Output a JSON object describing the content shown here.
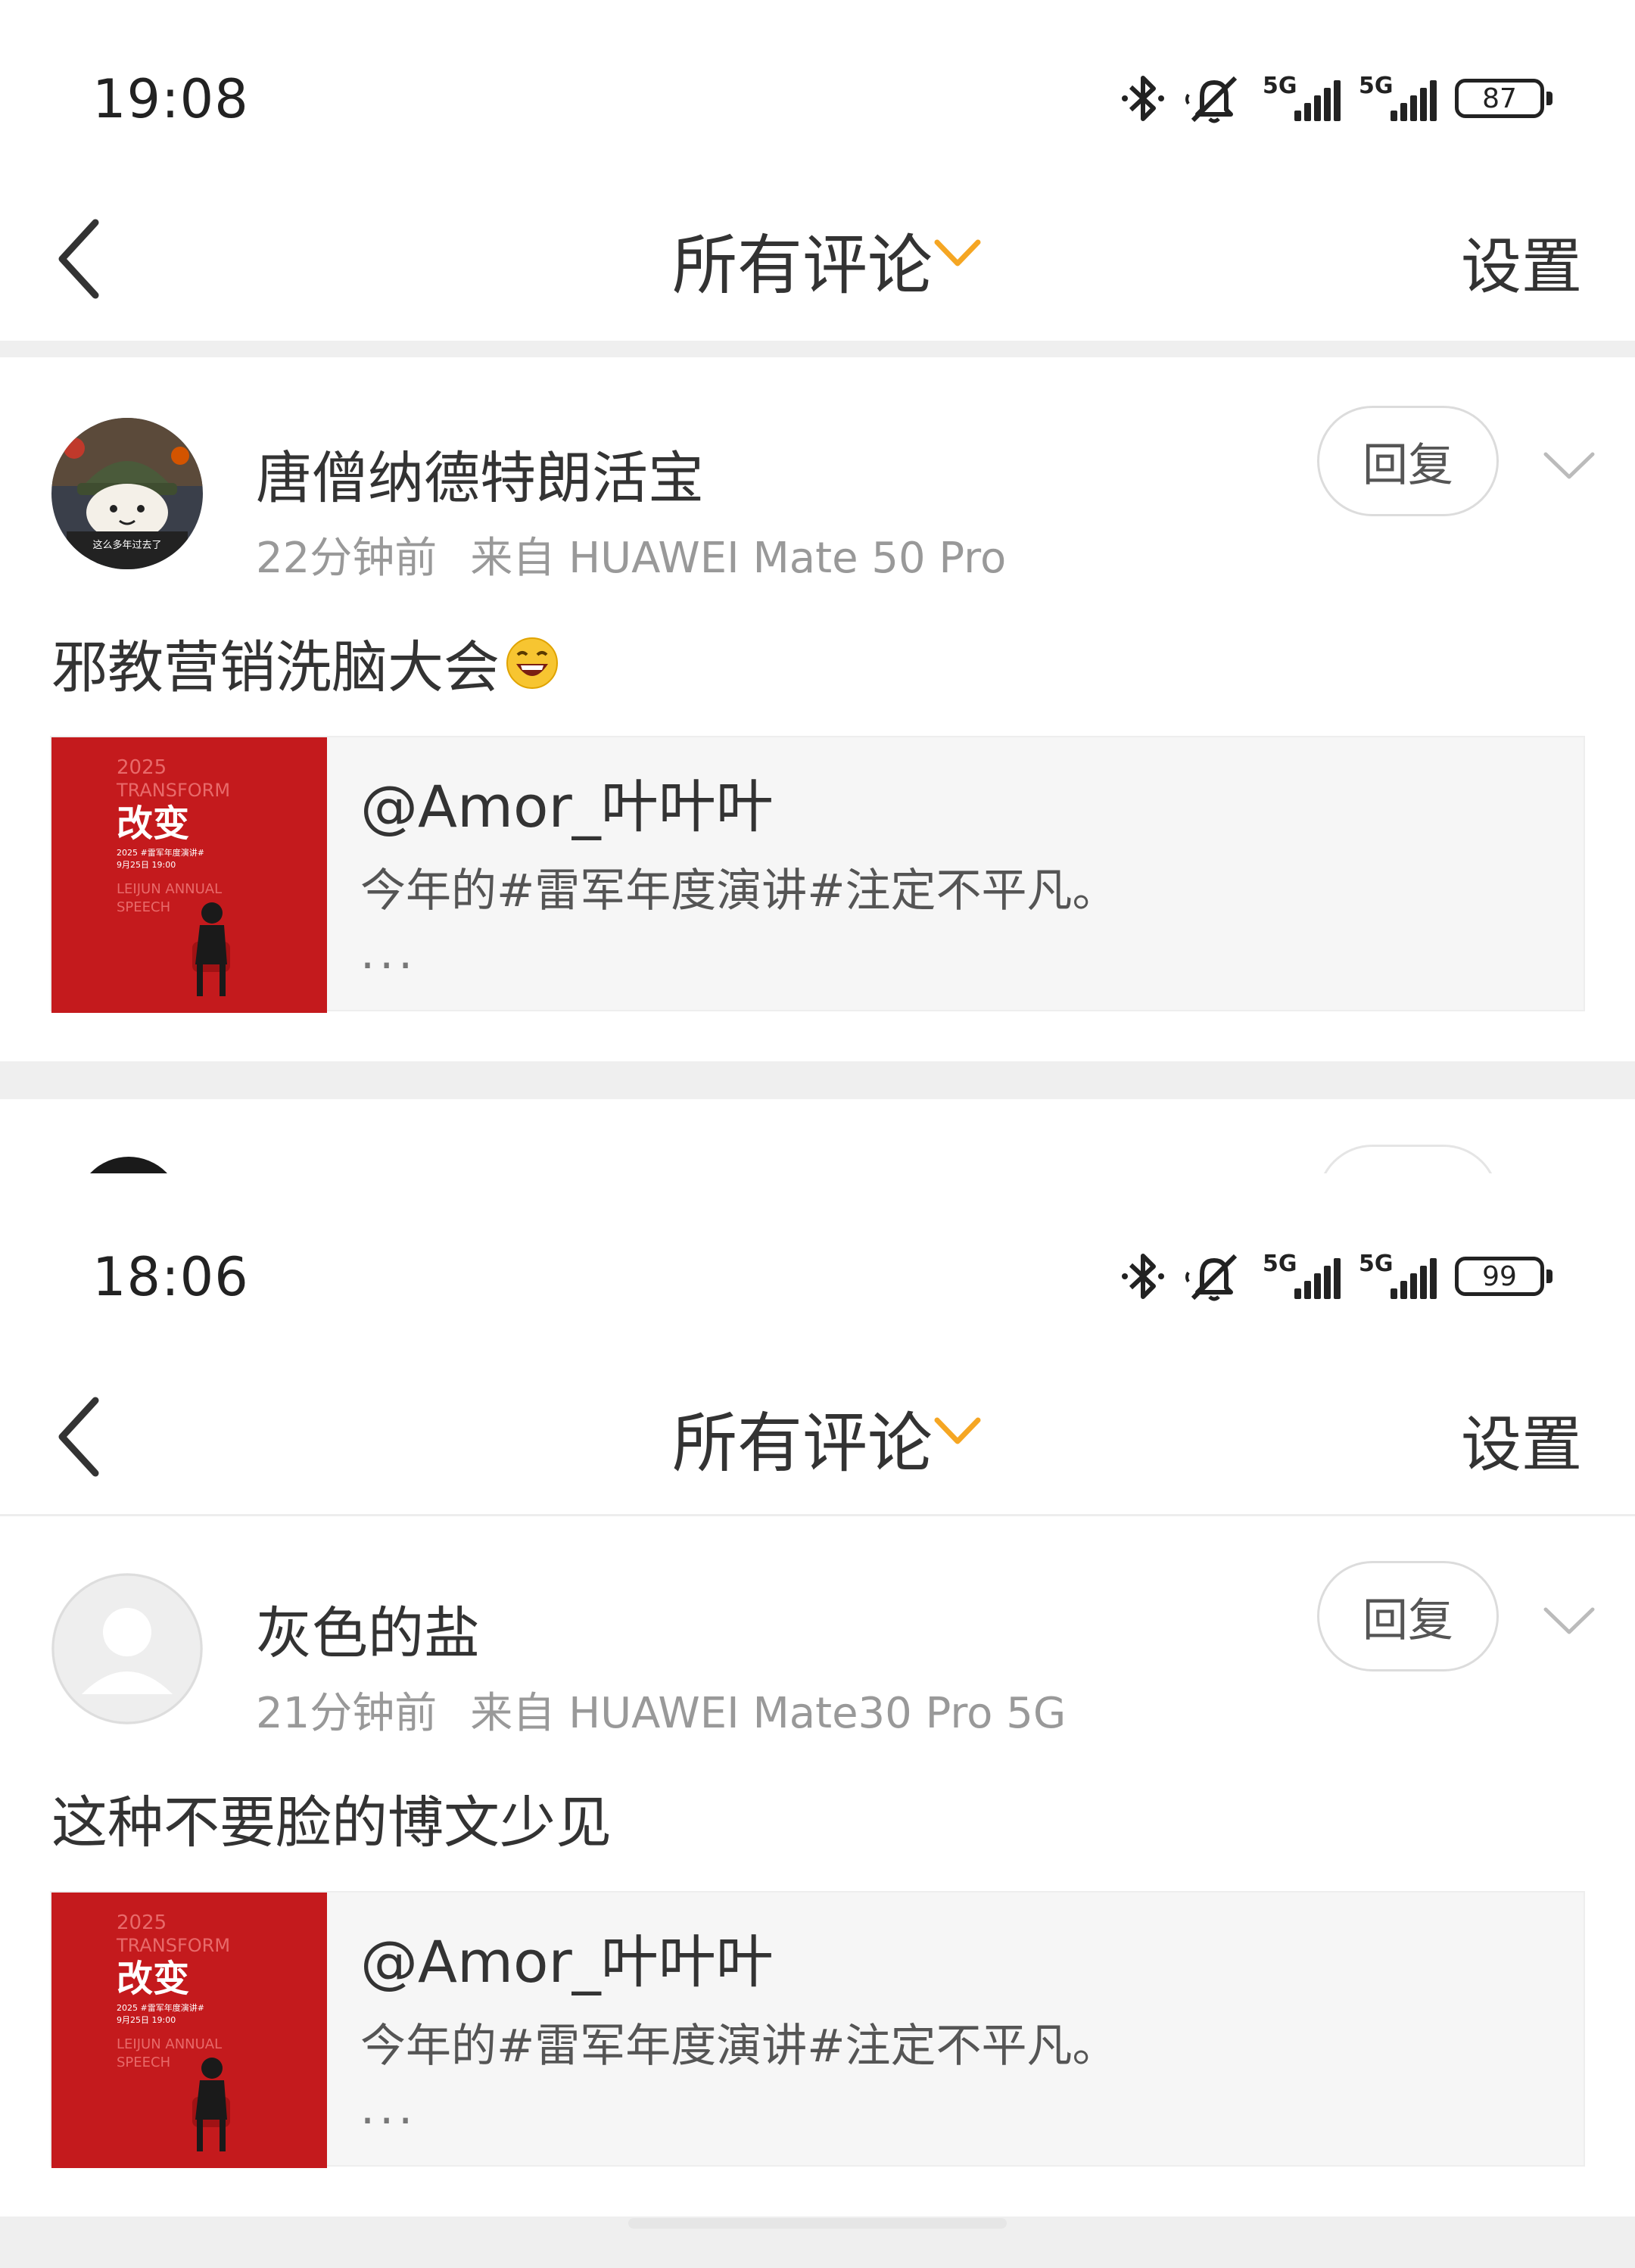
{
  "colors": {
    "accent": "#f5a623",
    "text": "#333333",
    "meta": "#999999",
    "thumb_red": "#c41a1d"
  },
  "screens": [
    {
      "status": {
        "time": "19:08",
        "battery": "87",
        "net1": "5G",
        "net2": "5G"
      },
      "nav": {
        "title": "所有评论",
        "settings": "设置"
      },
      "comment": {
        "username": "唐僧纳德特朗活宝",
        "time_ago": "22分钟前",
        "source": "来自 HUAWEI Mate 50 Pro",
        "reply_label": "回复",
        "text": "邪教营销洗脑大会",
        "avatar_caption": "这么多年过去了",
        "quote": {
          "author": "@Amor_叶叶叶",
          "text": "今年的#雷军年度演讲#注定不平凡。",
          "more": "..."
        }
      }
    },
    {
      "status": {
        "time": "18:06",
        "battery": "99",
        "net1": "5G",
        "net2": "5G"
      },
      "nav": {
        "title": "所有评论",
        "settings": "设置"
      },
      "comment": {
        "username": "灰色的盐",
        "time_ago": "21分钟前",
        "source": "来自 HUAWEI Mate30 Pro 5G",
        "reply_label": "回复",
        "text": "这种不要脸的博文少见",
        "quote": {
          "author": "@Amor_叶叶叶",
          "text": "今年的#雷军年度演讲#注定不平凡。",
          "more": "..."
        }
      }
    }
  ],
  "thumbnail": {
    "year": "2025",
    "word": "TRANSFORM",
    "title": "改变",
    "line1": "2025 #雷军年度演讲#",
    "line2": "9月25日 19:00",
    "line3": "LEIJUN ANNUAL",
    "line4": "SPEECH"
  }
}
